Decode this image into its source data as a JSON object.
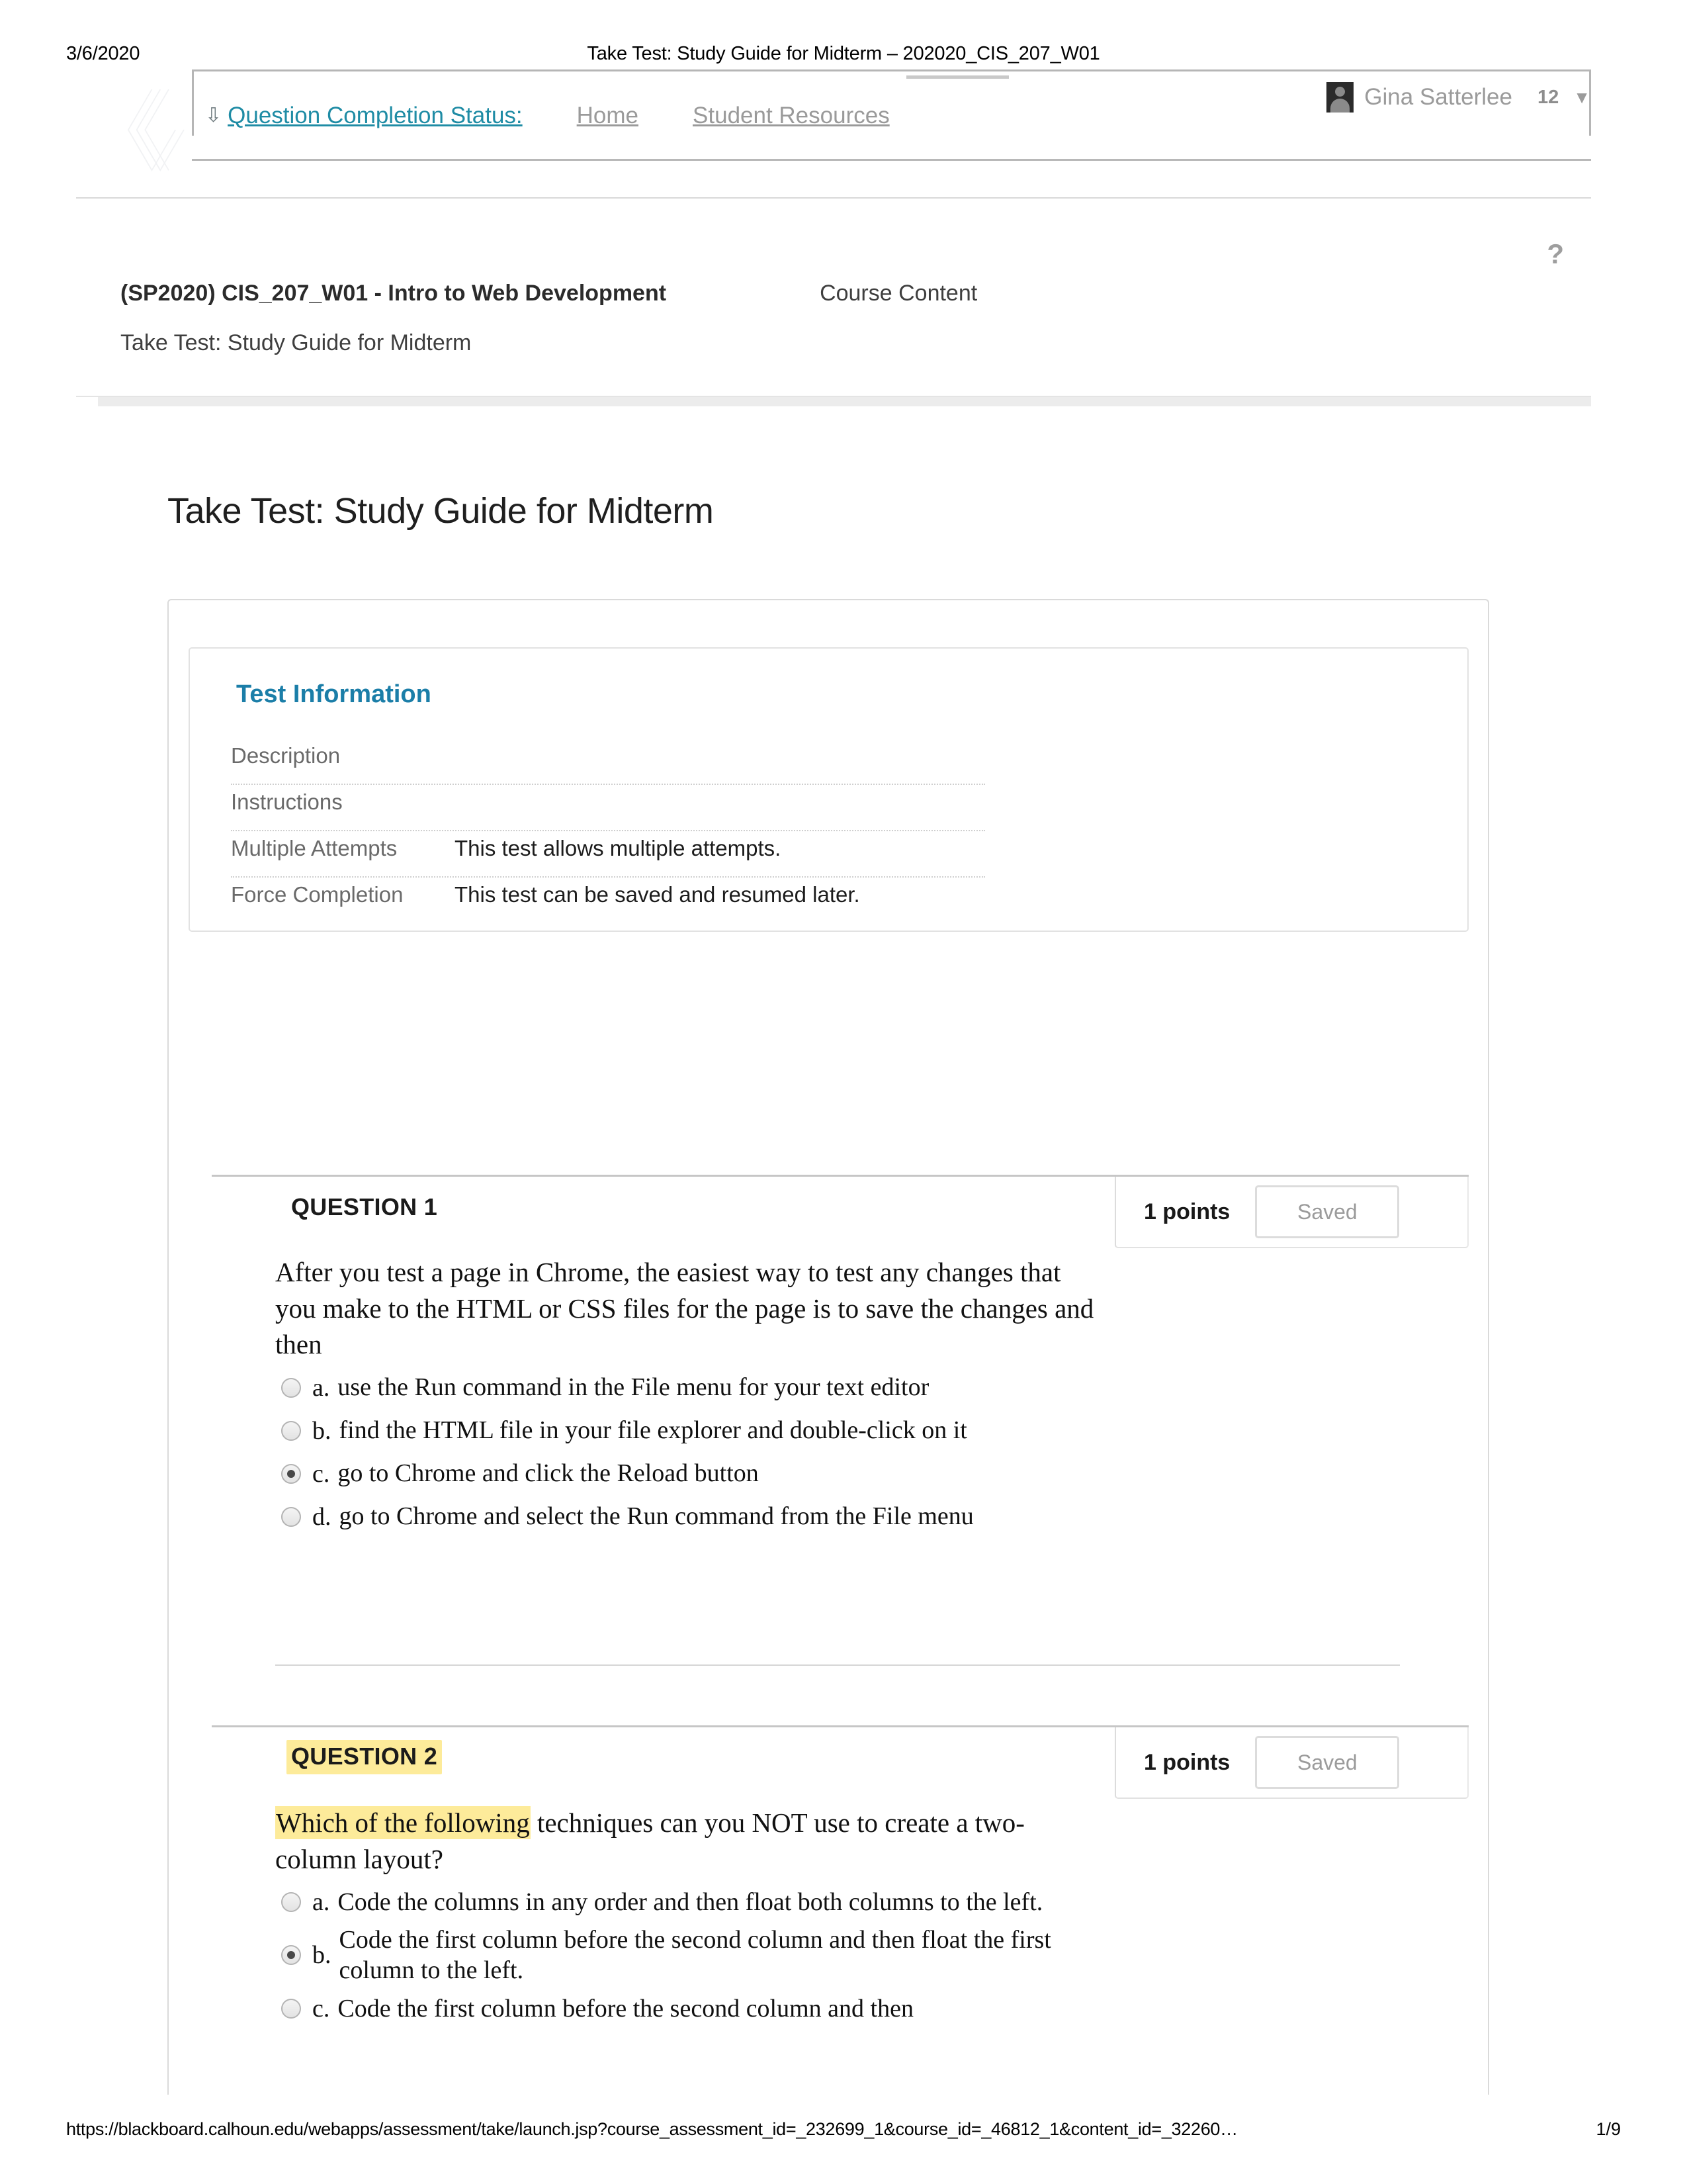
{
  "print": {
    "date": "3/6/2020",
    "doc_title": "Take Test: Study Guide for Midterm – 202020_CIS_207_W01"
  },
  "topnav": {
    "caret_icon": "chevron-double-down-icon",
    "question_completion_status": "Question Completion Status:",
    "tabs": [
      {
        "label": "Home"
      },
      {
        "label": "Student Resources"
      }
    ]
  },
  "user": {
    "avatar_icon": "user-avatar-icon",
    "name": "Gina Satterlee",
    "count": "12",
    "caret_icon": "chevron-down-icon"
  },
  "breadcrumb": {
    "course": "(SP2020) CIS_207_W01 - Intro to Web Development",
    "section": "Course Content",
    "current": "Take Test: Study Guide for Midterm",
    "help_icon": "?"
  },
  "page_title": "Take Test: Study Guide for Midterm",
  "test_information": {
    "heading": "Test Information",
    "rows": [
      {
        "label": "Description",
        "value": ""
      },
      {
        "label": "Instructions",
        "value": ""
      },
      {
        "label": "Multiple Attempts",
        "value": "This test allows multiple attempts."
      },
      {
        "label": "Force Completion",
        "value": "This test can be saved and resumed later."
      }
    ]
  },
  "questions": [
    {
      "label": "QUESTION 1",
      "highlighted_label": false,
      "points": "1 points",
      "status": "Saved",
      "prompt": "After you test a page in Chrome, the easiest way to test any changes that you make to the HTML or CSS files for the page is to save the changes and then",
      "prompt_highlight": "",
      "options": [
        {
          "letter": "a.",
          "text": "use the Run command in the File menu for your text editor",
          "selected": false
        },
        {
          "letter": "b.",
          "text": "find the HTML file in your file explorer and double-click on it",
          "selected": false
        },
        {
          "letter": "c.",
          "text": "go to Chrome and click the Reload button",
          "selected": true
        },
        {
          "letter": "d.",
          "text": "go to Chrome and select the Run command from the File menu",
          "selected": false
        }
      ]
    },
    {
      "label": "QUESTION 2",
      "highlighted_label": true,
      "points": "1 points",
      "status": "Saved",
      "prompt_highlight": "Which of the following",
      "prompt": " techniques can you NOT use to create a two-column layout?",
      "options": [
        {
          "letter": "a.",
          "text": "Code the columns in any order and then float both columns to the left.",
          "selected": false
        },
        {
          "letter": "b.",
          "text": "Code the first column before the second column and then float the first column to the left.",
          "selected": true
        },
        {
          "letter": "c.",
          "text": "Code the first column before the second column and then",
          "selected": false
        }
      ]
    }
  ],
  "footer": {
    "url": "https://blackboard.calhoun.edu/webapps/assessment/take/launch.jsp?course_assessment_id=_232699_1&course_id=_46812_1&content_id=_32260…",
    "page": "1/9"
  },
  "colors": {
    "link_teal": "#1f8ca5",
    "heading_blue": "#1b7ea8",
    "highlight_yellow": "#fdeb9a",
    "muted_gray": "#9a9a9a"
  }
}
